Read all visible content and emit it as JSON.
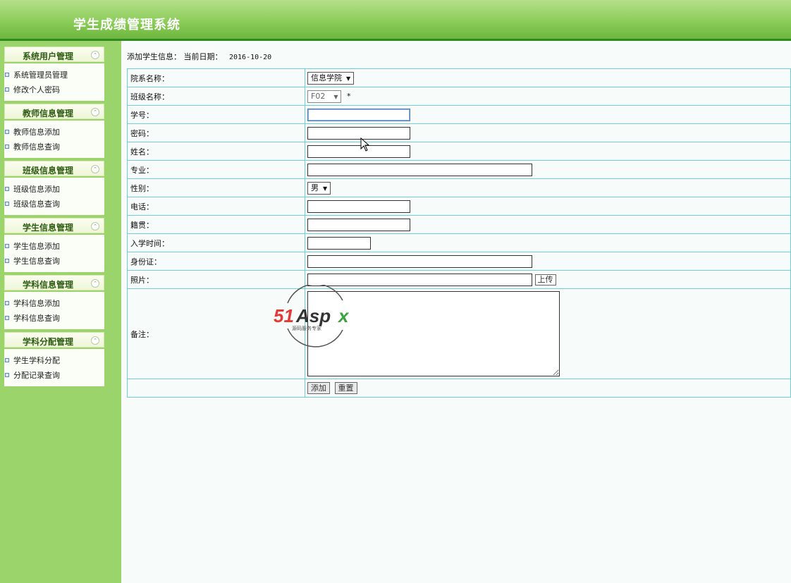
{
  "app_title": "学生成绩管理系统",
  "sidebar": {
    "groups": [
      {
        "title": "系统用户管理",
        "items": [
          "系统管理员管理",
          "修改个人密码"
        ]
      },
      {
        "title": "教师信息管理",
        "items": [
          "教师信息添加",
          "教师信息查询"
        ]
      },
      {
        "title": "班级信息管理",
        "items": [
          "班级信息添加",
          "班级信息查询"
        ]
      },
      {
        "title": "学生信息管理",
        "items": [
          "学生信息添加",
          "学生信息查询"
        ]
      },
      {
        "title": "学科信息管理",
        "items": [
          "学科信息添加",
          "学科信息查询"
        ]
      },
      {
        "title": "学科分配管理",
        "items": [
          "学生学科分配",
          "分配记录查询"
        ]
      }
    ],
    "toggle_icon": "collapse-up-icon"
  },
  "page": {
    "heading": "添加学生信息：",
    "date_label": "当前日期：",
    "date_value": "2016-10-20"
  },
  "form": {
    "department_label": "院系名称：",
    "department_value": "信息学院",
    "class_label": "班级名称：",
    "class_value": "F02",
    "class_required_mark": "*",
    "student_no_label": "学号：",
    "password_label": "密码：",
    "name_label": "姓名：",
    "major_label": "专业：",
    "gender_label": "性别：",
    "gender_value": "男",
    "phone_label": "电话：",
    "origin_label": "籍贯：",
    "enroll_label": "入学时间：",
    "id_label": "身份证：",
    "photo_label": "照片：",
    "upload_label": "上传",
    "remark_label": "备注：",
    "add_label": "添加",
    "reset_label": "重置"
  },
  "watermark": {
    "brand": "51Aspx",
    "tagline": "源码服务专家"
  }
}
